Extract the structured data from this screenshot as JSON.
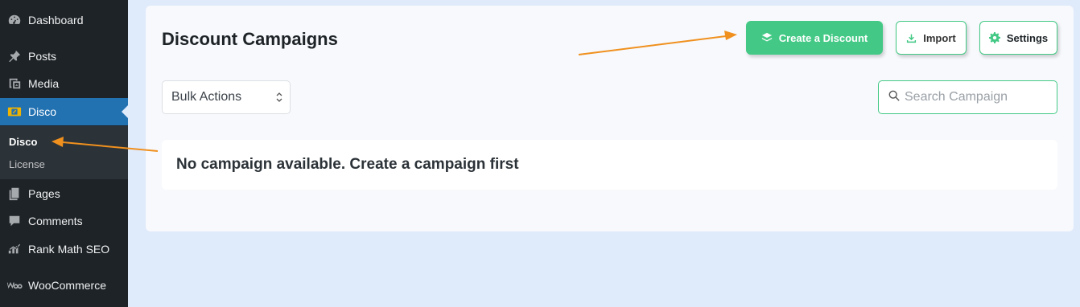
{
  "sidebar": {
    "items": [
      {
        "label": "Dashboard",
        "icon": "dashboard-icon"
      },
      {
        "label": "Posts",
        "icon": "pushpin-icon"
      },
      {
        "label": "Media",
        "icon": "media-icon"
      },
      {
        "label": "Disco",
        "icon": "disco-icon"
      },
      {
        "label": "Pages",
        "icon": "pages-icon"
      },
      {
        "label": "Comments",
        "icon": "comment-icon"
      },
      {
        "label": "Rank Math SEO",
        "icon": "rank-math-icon"
      },
      {
        "label": "WooCommerce",
        "icon": "woocommerce-icon"
      }
    ],
    "submenu": [
      {
        "label": "Disco"
      },
      {
        "label": "License"
      }
    ],
    "active_item": "Disco"
  },
  "main": {
    "title": "Discount Campaigns",
    "buttons": {
      "create": "Create a Discount",
      "import": "Import",
      "settings": "Settings"
    },
    "bulk_actions": {
      "selected": "Bulk Actions"
    },
    "search": {
      "placeholder": "Search Campaign",
      "value": ""
    },
    "empty_message": "No campaign available. Create a campaign first"
  },
  "colors": {
    "accent_green": "#43c985",
    "sidebar_bg": "#1d2327",
    "active_blue": "#2271b1",
    "annotation_arrow": "#f0901e"
  }
}
